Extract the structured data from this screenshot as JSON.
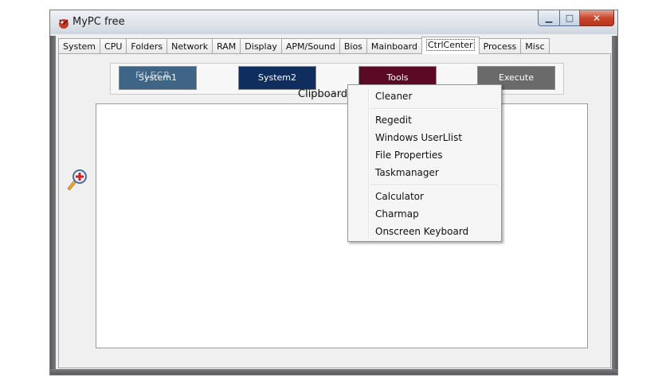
{
  "window": {
    "title": "MyPC free"
  },
  "tabs": [
    {
      "label": "System"
    },
    {
      "label": "CPU"
    },
    {
      "label": "Folders"
    },
    {
      "label": "Network"
    },
    {
      "label": "RAM"
    },
    {
      "label": "Display"
    },
    {
      "label": "APM/Sound"
    },
    {
      "label": "Bios"
    },
    {
      "label": "Mainboard"
    },
    {
      "label": "CtrlCenter",
      "active": true
    },
    {
      "label": "Process"
    },
    {
      "label": "Misc"
    }
  ],
  "buttons": [
    {
      "label": "System1",
      "color": "#3e6585"
    },
    {
      "label": "System2",
      "color": "#0f2e5e"
    },
    {
      "label": "Tools",
      "color": "#5a0a24"
    },
    {
      "label": "Execute",
      "color": "#6a6a6a"
    }
  ],
  "watermark": "FILECR",
  "clipboard": {
    "label": "Clipboard V"
  },
  "context_menu": {
    "items": [
      {
        "label": "Cleaner"
      },
      {
        "label": "Regedit"
      },
      {
        "label": "Windows UserLlist"
      },
      {
        "label": "File Properties"
      },
      {
        "label": "Taskmanager"
      },
      {
        "label": "Calculator"
      },
      {
        "label": "Charmap"
      },
      {
        "label": "Onscreen Keyboard"
      }
    ]
  },
  "icons": {
    "app": "mypc-app-icon",
    "zoom": "zoom-in-icon",
    "minimize": "minimize-icon",
    "maximize": "maximize-icon",
    "close": "close-icon"
  }
}
